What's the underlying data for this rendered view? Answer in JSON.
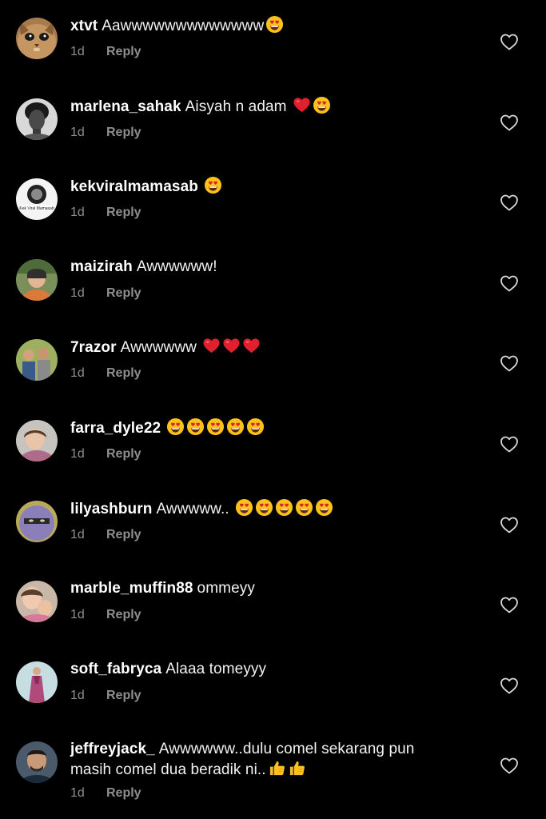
{
  "comments": [
    {
      "username": "xtvt",
      "text": "Aawwwwwwwwwwwww",
      "emojis": [
        "heart-eyes"
      ],
      "time": "1d",
      "reply": "Reply",
      "avatar": "cat-avatar"
    },
    {
      "username": "marlena_sahak",
      "text": "Aisyah n adam",
      "emojis": [
        "red-heart",
        "heart-eyes"
      ],
      "time": "1d",
      "reply": "Reply",
      "avatar": "portrait-bw-avatar"
    },
    {
      "username": "kekviralmamasab",
      "text": "",
      "emojis": [
        "heart-eyes"
      ],
      "time": "1d",
      "reply": "Reply",
      "avatar": "logo-avatar",
      "avatar_text": "Kek Viral Mamasab"
    },
    {
      "username": "maizirah",
      "text": "Awwwwww!",
      "emojis": [],
      "time": "1d",
      "reply": "Reply",
      "avatar": "photo-avatar"
    },
    {
      "username": "7razor",
      "text": "Awwwwww",
      "emojis": [
        "red-heart",
        "red-heart",
        "red-heart"
      ],
      "time": "1d",
      "reply": "Reply",
      "avatar": "group-photo-avatar"
    },
    {
      "username": "farra_dyle22",
      "text": "",
      "emojis": [
        "heart-eyes",
        "heart-eyes",
        "heart-eyes",
        "heart-eyes",
        "heart-eyes"
      ],
      "time": "1d",
      "reply": "Reply",
      "avatar": "photo-avatar"
    },
    {
      "username": "lilyashburn",
      "text": "Awwwww..",
      "emojis": [
        "heart-eyes",
        "heart-eyes",
        "heart-eyes",
        "heart-eyes",
        "heart-eyes"
      ],
      "time": "1d",
      "reply": "Reply",
      "avatar": "hijab-avatar"
    },
    {
      "username": "marble_muffin88",
      "text": "ommeyy",
      "emojis": [],
      "time": "1d",
      "reply": "Reply",
      "avatar": "family-avatar"
    },
    {
      "username": "soft_fabryca",
      "text": "Alaaa tomeyyy",
      "emojis": [],
      "time": "1d",
      "reply": "Reply",
      "avatar": "dress-avatar"
    },
    {
      "username": "jeffreyjack_",
      "text": "Awwwwww..dulu comel sekarang pun masih comel dua beradik ni..",
      "emojis": [
        "thumbs-up",
        "thumbs-up"
      ],
      "time": "1d",
      "reply": "Reply",
      "avatar": "man-avatar"
    }
  ],
  "colors": {
    "background": "#000000",
    "text": "#ffffff",
    "muted": "#8e8e8e",
    "heart_red": "#e0202e",
    "emoji_yellow": "#fcc21b"
  }
}
